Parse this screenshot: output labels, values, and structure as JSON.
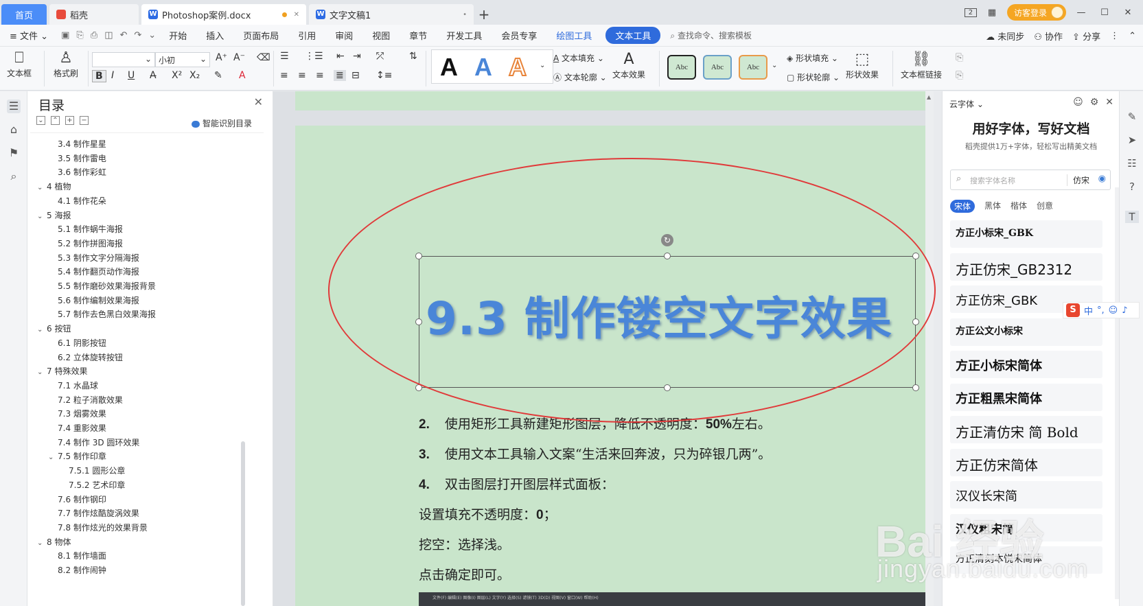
{
  "tabs": {
    "home": "首页",
    "t2": "稻壳",
    "t3": "Photoshop案例.docx",
    "t4": "文字文稿1",
    "new": "+",
    "badge": "2",
    "guest": "访客登录"
  },
  "menu": {
    "file": "文件",
    "items": [
      "开始",
      "插入",
      "页面布局",
      "引用",
      "审阅",
      "视图",
      "章节",
      "开发工具",
      "会员专享"
    ],
    "draw_tool": "绘图工具",
    "text_tool": "文本工具",
    "search": "查找命令、搜索模板",
    "sync": "未同步",
    "collab": "协作",
    "share": "分享"
  },
  "ribbon": {
    "textbox": "文本框",
    "format_brush": "格式刷",
    "font_size": "小初",
    "text_fill": "文本填充",
    "text_outline": "文本轮廓",
    "text_effect": "文本效果",
    "abc": "Abc",
    "shape_fill": "形状填充",
    "shape_outline": "形状轮廓",
    "shape_effect": "形状效果",
    "textbox_link": "文本框链接"
  },
  "toc": {
    "title": "目录",
    "smart": "智能识别目录",
    "items": [
      {
        "label": "3.4 制作星星",
        "level": 2
      },
      {
        "label": "3.5 制作雷电",
        "level": 2
      },
      {
        "label": "3.6 制作彩虹",
        "level": 2
      },
      {
        "label": "4 植物",
        "level": 1
      },
      {
        "label": "4.1 制作花朵",
        "level": 2
      },
      {
        "label": "5 海报",
        "level": 1
      },
      {
        "label": "5.1 制作蜗牛海报",
        "level": 2
      },
      {
        "label": "5.2 制作拼图海报",
        "level": 2
      },
      {
        "label": "5.3 制作文字分隔海报",
        "level": 2
      },
      {
        "label": "5.4 制作翻页动作海报",
        "level": 2
      },
      {
        "label": "5.5 制作磨砂效果海报背景",
        "level": 2
      },
      {
        "label": "5.6 制作编制效果海报",
        "level": 2
      },
      {
        "label": "5.7 制作去色黑白效果海报",
        "level": 2
      },
      {
        "label": "6 按钮",
        "level": 1
      },
      {
        "label": "6.1 阴影按钮",
        "level": 2
      },
      {
        "label": "6.2 立体旋转按钮",
        "level": 2
      },
      {
        "label": "7 特殊效果",
        "level": 1
      },
      {
        "label": "7.1 水晶球",
        "level": 2
      },
      {
        "label": "7.2 粒子消散效果",
        "level": 2
      },
      {
        "label": "7.3 烟雾效果",
        "level": 2
      },
      {
        "label": "7.4 重影效果",
        "level": 2
      },
      {
        "label": "7.4 制作 3D 圆环效果",
        "level": 2
      },
      {
        "label": "7.5 制作印章",
        "level": 2,
        "expanded": true
      },
      {
        "label": "7.5.1 圆形公章",
        "level": 3
      },
      {
        "label": "7.5.2 艺术印章",
        "level": 3
      },
      {
        "label": "7.6 制作钢印",
        "level": 2
      },
      {
        "label": "7.7 制作炫酷旋涡效果",
        "level": 2
      },
      {
        "label": "7.8 制作炫光的效果背景",
        "level": 2
      },
      {
        "label": "8 物体",
        "level": 1
      },
      {
        "label": "8.1 制作墙面",
        "level": 2
      },
      {
        "label": "8.2 制作闹钟",
        "level": 2
      }
    ]
  },
  "doc": {
    "headline": "9.3 制作镂空文字效果",
    "p2_num": "2.",
    "p2_text": "使用矩形工具新建矩形图层，降低不透明度：",
    "p2_bold": "50%",
    "p2_tail": "左右。",
    "p3_num": "3.",
    "p3_text": "使用文本工具输入文案“生活来回奔波，只为碎银几两”。",
    "p4_num": "4.",
    "p4_text": "双击图层打开图层样式面板：",
    "p5_text": "设置填充不透明度：",
    "p5_bold": "0",
    "p5_tail": "；",
    "p6_text": "挖空：选择浅。",
    "p7_text": "点击确定即可。",
    "thumb_menu": "文件(F)  编辑(E)  图像(I)  图层(L)  文字(Y)  选择(S)  滤镜(T)  3D(D)  视图(V)  窗口(W)  帮助(H)"
  },
  "font_panel": {
    "header": "云字体",
    "big": "用好字体，写好文档",
    "sub": "稻壳提供1万+字体，轻松写出精美文档",
    "search_placeholder": "搜索字体名称",
    "similar": "仿宋",
    "cats": [
      "宋体",
      "黑体",
      "楷体",
      "创意"
    ],
    "fonts": [
      "方正小标宋_GBK",
      "方正仿宋_GB2312",
      "方正仿宋_GBK",
      "方正公文小标宋",
      "方正小标宋简体",
      "方正粗黑宋简体",
      "方正清仿宋 简 Bold",
      "方正仿宋简体",
      "汉仪长宋简",
      "汉仪粗宋简",
      "方正清刻本悦宋简体"
    ]
  },
  "ime": {
    "logo": "S",
    "mode": "中"
  },
  "watermark": {
    "main": "Bai 经验",
    "sub": "jingyan.baidu.com"
  }
}
